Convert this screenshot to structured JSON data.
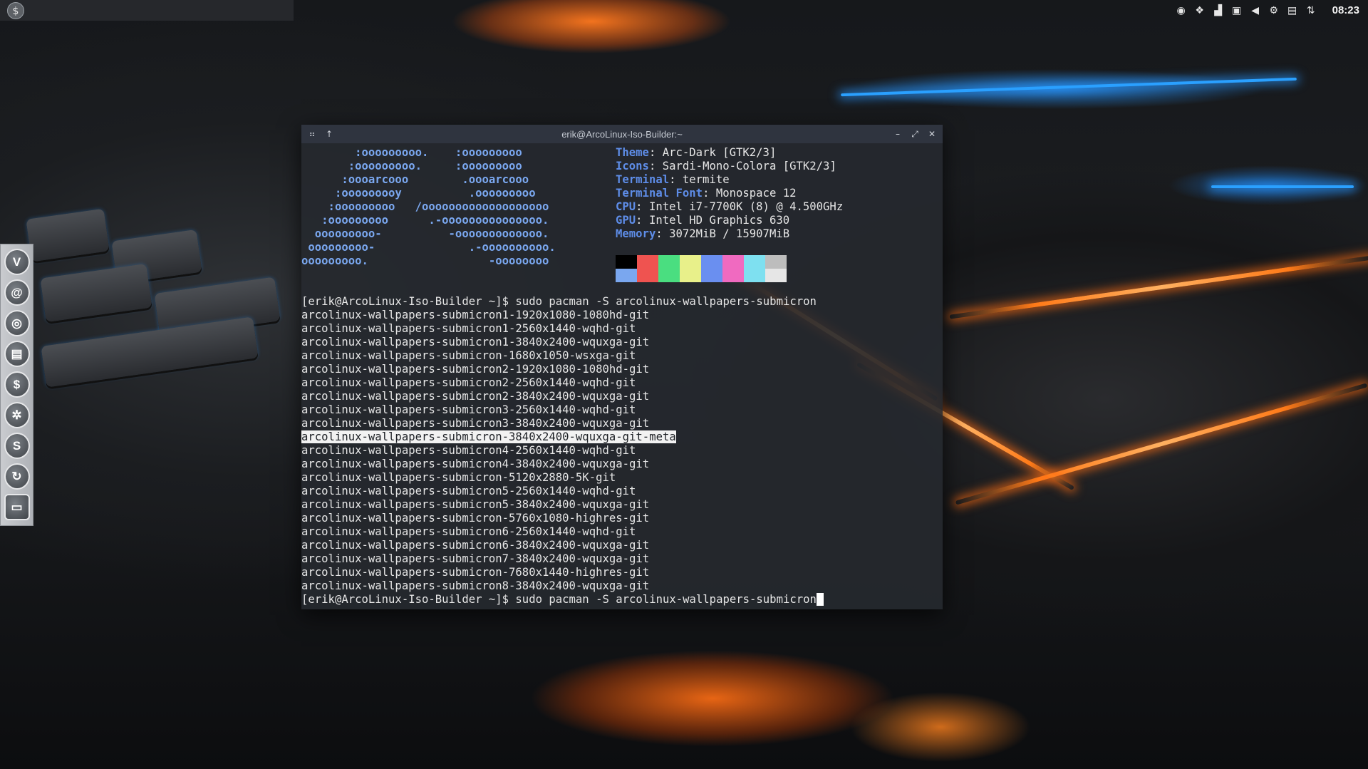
{
  "top_panel": {
    "app_menu_icon": "arcolinux-logo-icon",
    "tray_icons": [
      "network-icon",
      "dropbox-icon",
      "volume-bars-icon",
      "screen-icon",
      "speaker-icon",
      "settings-gear-icon",
      "clipboard-icon",
      "network-transfer-icon"
    ],
    "clock": "08:23"
  },
  "dock": {
    "items": [
      {
        "name": "vivaldi-icon",
        "glyph": "V"
      },
      {
        "name": "spiral-app-icon",
        "glyph": "@"
      },
      {
        "name": "chromium-icon",
        "glyph": "◎"
      },
      {
        "name": "file-manager-icon",
        "glyph": "▤"
      },
      {
        "name": "terminal-icon",
        "glyph": "$"
      },
      {
        "name": "screenshot-icon",
        "glyph": "✲"
      },
      {
        "name": "skype-icon",
        "glyph": "S"
      },
      {
        "name": "system-icon",
        "glyph": "↻"
      },
      {
        "name": "show-desktop-icon",
        "glyph": "▭"
      }
    ]
  },
  "terminal": {
    "title": "erik@ArcoLinux-Iso-Builder:~",
    "neofetch_logo": [
      "        :ooooooooo.    :ooooooooo",
      "       :ooooooooo.     :ooooooooo",
      "      :oooarcooo        .oooarcooo",
      "     :ooooooooy          .ooooooooo",
      "    :ooooooooo   /ooooooooooooooooooo",
      "   :ooooooooo      .-ooooooooooooooo.",
      "  ooooooooo-          -ooooooooooooo.",
      " ooooooooo-              .-oooooooooo.",
      "ooooooooo.                  -oooooooo"
    ],
    "info": [
      {
        "key": "Theme",
        "value": "Arc-Dark [GTK2/3]"
      },
      {
        "key": "Icons",
        "value": "Sardi-Mono-Colora [GTK2/3]"
      },
      {
        "key": "Terminal",
        "value": "termite"
      },
      {
        "key": "Terminal Font",
        "value": "Monospace 12"
      },
      {
        "key": "CPU",
        "value": "Intel i7-7700K (8) @ 4.500GHz"
      },
      {
        "key": "GPU",
        "value": "Intel HD Graphics 630"
      },
      {
        "key": "Memory",
        "value": "3072MiB / 15907MiB"
      }
    ],
    "palette_top": [
      "#000000",
      "#ef5350",
      "#4ade80",
      "#e8f08a",
      "#6a8ff0",
      "#f06ac0",
      "#7ee0f0",
      "#bdbdbd"
    ],
    "palette_bottom": [
      "#7aa7ef",
      "#ef5350",
      "#4ade80",
      "#e8f08a",
      "#6a8ff0",
      "#f06ac0",
      "#7ee0f0",
      "#e6e6e6"
    ],
    "output_lines": [
      "[erik@ArcoLinux-Iso-Builder ~]$ sudo pacman -S arcolinux-wallpapers-submicron",
      "arcolinux-wallpapers-submicron1-1920x1080-1080hd-git",
      "arcolinux-wallpapers-submicron1-2560x1440-wqhd-git",
      "arcolinux-wallpapers-submicron1-3840x2400-wquxga-git",
      "arcolinux-wallpapers-submicron-1680x1050-wsxga-git",
      "arcolinux-wallpapers-submicron2-1920x1080-1080hd-git",
      "arcolinux-wallpapers-submicron2-2560x1440-wqhd-git",
      "arcolinux-wallpapers-submicron2-3840x2400-wquxga-git",
      "arcolinux-wallpapers-submicron3-2560x1440-wqhd-git",
      "arcolinux-wallpapers-submicron3-3840x2400-wquxga-git",
      "arcolinux-wallpapers-submicron-3840x2400-wquxga-git-meta",
      "arcolinux-wallpapers-submicron4-2560x1440-wqhd-git",
      "arcolinux-wallpapers-submicron4-3840x2400-wquxga-git",
      "arcolinux-wallpapers-submicron-5120x2880-5K-git",
      "arcolinux-wallpapers-submicron5-2560x1440-wqhd-git",
      "arcolinux-wallpapers-submicron5-3840x2400-wquxga-git",
      "arcolinux-wallpapers-submicron-5760x1080-highres-git",
      "arcolinux-wallpapers-submicron6-2560x1440-wqhd-git",
      "arcolinux-wallpapers-submicron6-3840x2400-wquxga-git",
      "arcolinux-wallpapers-submicron7-3840x2400-wquxga-git",
      "arcolinux-wallpapers-submicron-7680x1440-highres-git",
      "arcolinux-wallpapers-submicron8-3840x2400-wquxga-git",
      "[erik@ArcoLinux-Iso-Builder ~]$ sudo pacman -S arcolinux-wallpapers-submicron"
    ],
    "selected_line_index": 10
  }
}
